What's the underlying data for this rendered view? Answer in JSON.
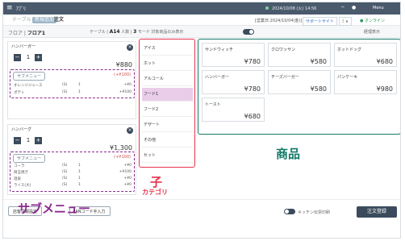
{
  "topbar": {
    "app_name": "ｱﾌﾟﾘ",
    "clock": "2024/10/08 (火) 14:56",
    "user": "Menu"
  },
  "subbar": {
    "crumb_tables": "テーブル",
    "crumb_selected": "新規追加",
    "crumb_title": "注文",
    "sales_date": "[営業日:2024/10/04(金)]",
    "support": "サポートサイト",
    "select": "ﾐ ∨",
    "online": "● オンライン"
  },
  "filterbar": {
    "floor_prefix": "フロア",
    "floor": "フロア1",
    "table_label": "テーブル",
    "table": "A14",
    "people_label": "人数",
    "people": "3",
    "mode": "モード 対象商品のみ表示",
    "extra": "経理表示"
  },
  "orders": [
    {
      "name": "ハンバーガー",
      "qty": "1",
      "price": "¥880",
      "submenu_button": "サブメニュー",
      "submenu_add": "(+¥100)",
      "sub_rows": [
        {
          "c1": "オレンジジュース",
          "c2": "(S)",
          "c3": "1",
          "c4": "+¥0"
        },
        {
          "c1": "ポテト",
          "c2": "(S)",
          "c3": "1",
          "c4": "+¥100"
        }
      ]
    },
    {
      "name": "ハンバーグ",
      "qty": "1",
      "price": "¥1,300",
      "submenu_button": "サブメニュー",
      "submenu_add": "(+¥100)",
      "sub_rows": [
        {
          "c1": "コーラ",
          "c2": "(S)",
          "c3": "1",
          "c4": "+¥0"
        },
        {
          "c1": "目玉焼き",
          "c2": "(S)",
          "c3": "1",
          "c4": "+¥100"
        },
        {
          "c1": "温泉",
          "c2": "(S)",
          "c3": "1",
          "c4": "+¥0"
        },
        {
          "c1": "ライス(大)",
          "c2": "(S)",
          "c3": "1",
          "c4": "+¥0"
        }
      ]
    }
  ],
  "categories": [
    "アイス",
    "ホット",
    "アルコール",
    "フード1",
    "フード2",
    "デザート",
    "その他",
    "セット"
  ],
  "active_category": "フード1",
  "products": [
    {
      "name": "サンドウィッチ",
      "price": "¥780"
    },
    {
      "name": "クロワッサン",
      "price": "¥580"
    },
    {
      "name": "ホットドッグ",
      "price": "¥680"
    },
    {
      "name": "ハンバーガー",
      "price": "¥780"
    },
    {
      "name": "チーズバーガー",
      "price": "¥580"
    },
    {
      "name": "パンケーキ",
      "price": "¥980"
    },
    {
      "name": "トースト",
      "price": "¥680"
    }
  ],
  "annotations": {
    "submenu": "サブメニュー",
    "child": "子",
    "category": "カテゴリ",
    "products": "商品"
  },
  "bottombar": {
    "btn1": "店客情報設定",
    "btn2": "JANコード手入力",
    "kitchen": "キッチン伝票印刷",
    "register": "注文登録"
  },
  "colors": {
    "submenu_accent": "#8a2b8f",
    "category_accent": "#e6334e",
    "product_accent": "#127a68",
    "primary": "#3b4b5c"
  }
}
